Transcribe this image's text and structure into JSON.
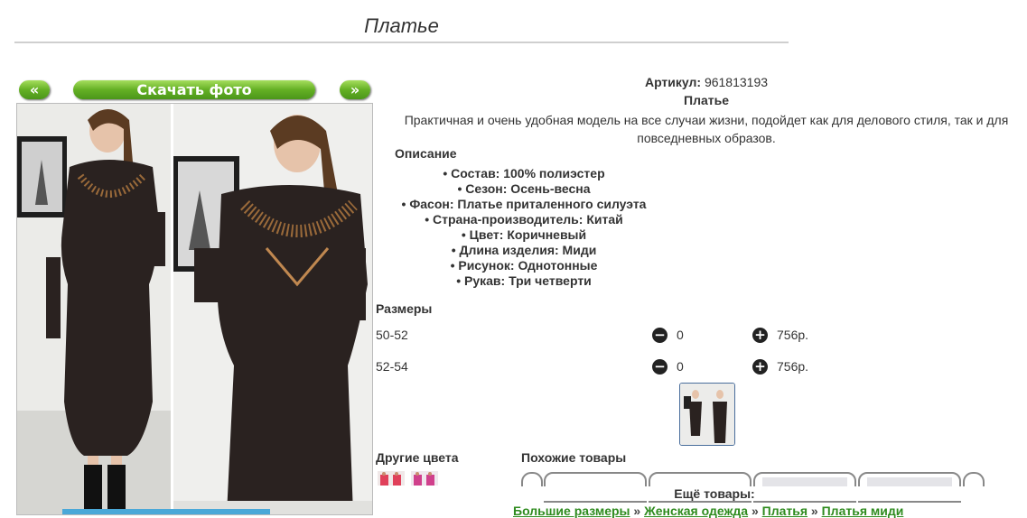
{
  "title": "Платье",
  "nav": {
    "prev_label": "«",
    "download_label": "Скачать фото",
    "next_label": "»"
  },
  "product": {
    "article_label": "Артикул:",
    "article_value": "961813193",
    "name": "Платье",
    "description": "Практичная и очень удобная модель на все случаи жизни, подойдет как для делового стиля, так и для повседневных образов."
  },
  "description_heading": "Описание",
  "specs": [
    "Состав: 100% полиэстер",
    "Сезон: Осень-весна",
    "Фасон: Платье приталенного силуэта",
    "Страна-производитель: Китай",
    "Цвет: Коричневый",
    "Длина изделия: Миди",
    "Рисунок: Однотонные",
    "Рукав: Три четверти"
  ],
  "sizes_heading": "Размеры",
  "sizes": [
    {
      "label": "50-52",
      "qty": "0",
      "price": "756р.",
      "minus_icon": "minus-icon",
      "plus_icon": "plus-icon"
    },
    {
      "label": "52-54",
      "qty": "0",
      "price": "756р.",
      "minus_icon": "minus-icon",
      "plus_icon": "plus-icon"
    }
  ],
  "other_colors_heading": "Другие цвета",
  "similar_heading": "Похожие товары",
  "more_heading": "Ещё товары:",
  "breadcrumb": {
    "items": [
      "Большие размеры",
      "Женская одежда",
      "Платья",
      "Платья миди"
    ],
    "separator": "»"
  },
  "colors": {
    "button_green": "#5aa820",
    "dress": "#2a2220",
    "link_green": "#2e8b1e",
    "thumb_border": "#4a6e9c"
  }
}
